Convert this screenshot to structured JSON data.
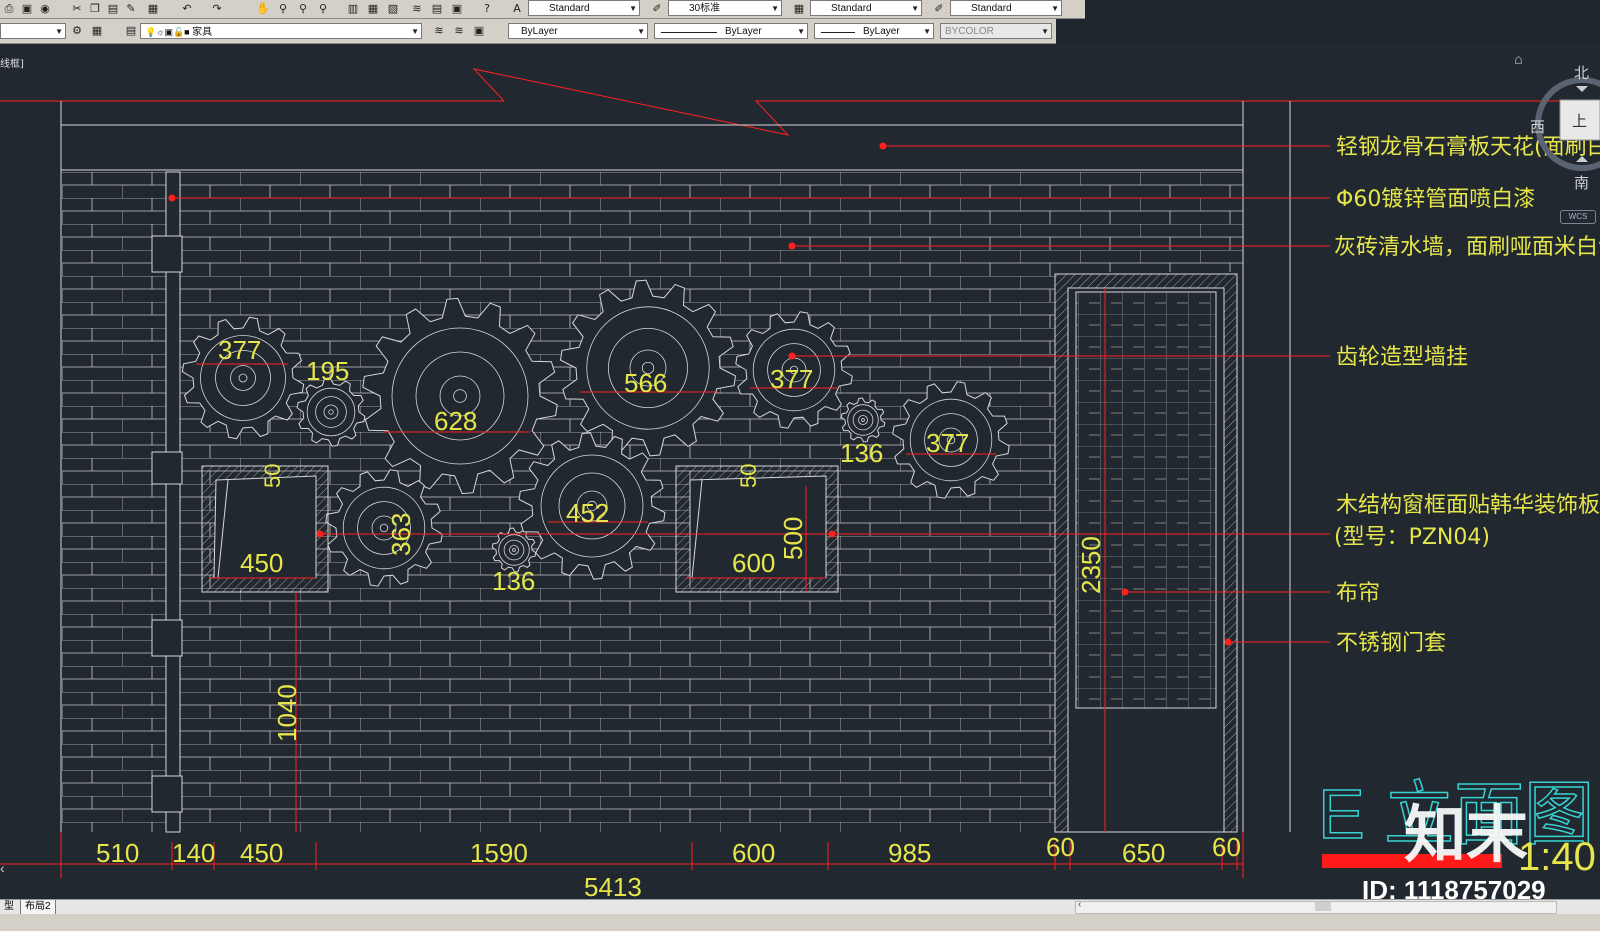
{
  "toolbar": {
    "text_style": "Standard",
    "dim_style": "30标准",
    "table_style": "Standard",
    "multileader_style": "Standard",
    "layer_name": "家具",
    "color": "ByLayer",
    "linetype": "ByLayer",
    "lineweight": "ByLayer",
    "plot_style": "BYCOLOR"
  },
  "viewport_label": "线框]",
  "navcube": {
    "north": "北",
    "west": "西",
    "south": "南",
    "face": "上",
    "wcs": "WCS"
  },
  "tabs": [
    "型",
    "布局2"
  ],
  "annotations": [
    "轻钢龙骨石膏板天花(面刷白色乳胶",
    "Φ60镀锌管面喷白漆",
    "灰砖清水墙，面刷哑面米白色乳胶漆",
    "齿轮造型墙挂",
    "木结构窗框面贴韩华装饰板",
    "(型号：PZN04)",
    "布帘",
    "不锈钢门套"
  ],
  "gear_dims": [
    "377",
    "195",
    "628",
    "566",
    "377",
    "136",
    "377",
    "363",
    "136",
    "452"
  ],
  "window_dims": [
    "50",
    "450",
    "50",
    "600",
    "500"
  ],
  "vertical_dims": [
    "1040",
    "2350"
  ],
  "bottom_dims": [
    "510",
    "140",
    "450",
    "1590",
    "600",
    "985",
    "60",
    "650",
    "60"
  ],
  "total_dim": "5413",
  "title": "E 立面图",
  "scale": "1:40",
  "watermark_brand": "知末",
  "watermark_id": "ID: 1118757029",
  "colors": {
    "background": "#212830",
    "lines": "#d8d8d8",
    "dims_text": "#e6e64a",
    "leader": "#ff2020",
    "title": "#37d3d3"
  }
}
